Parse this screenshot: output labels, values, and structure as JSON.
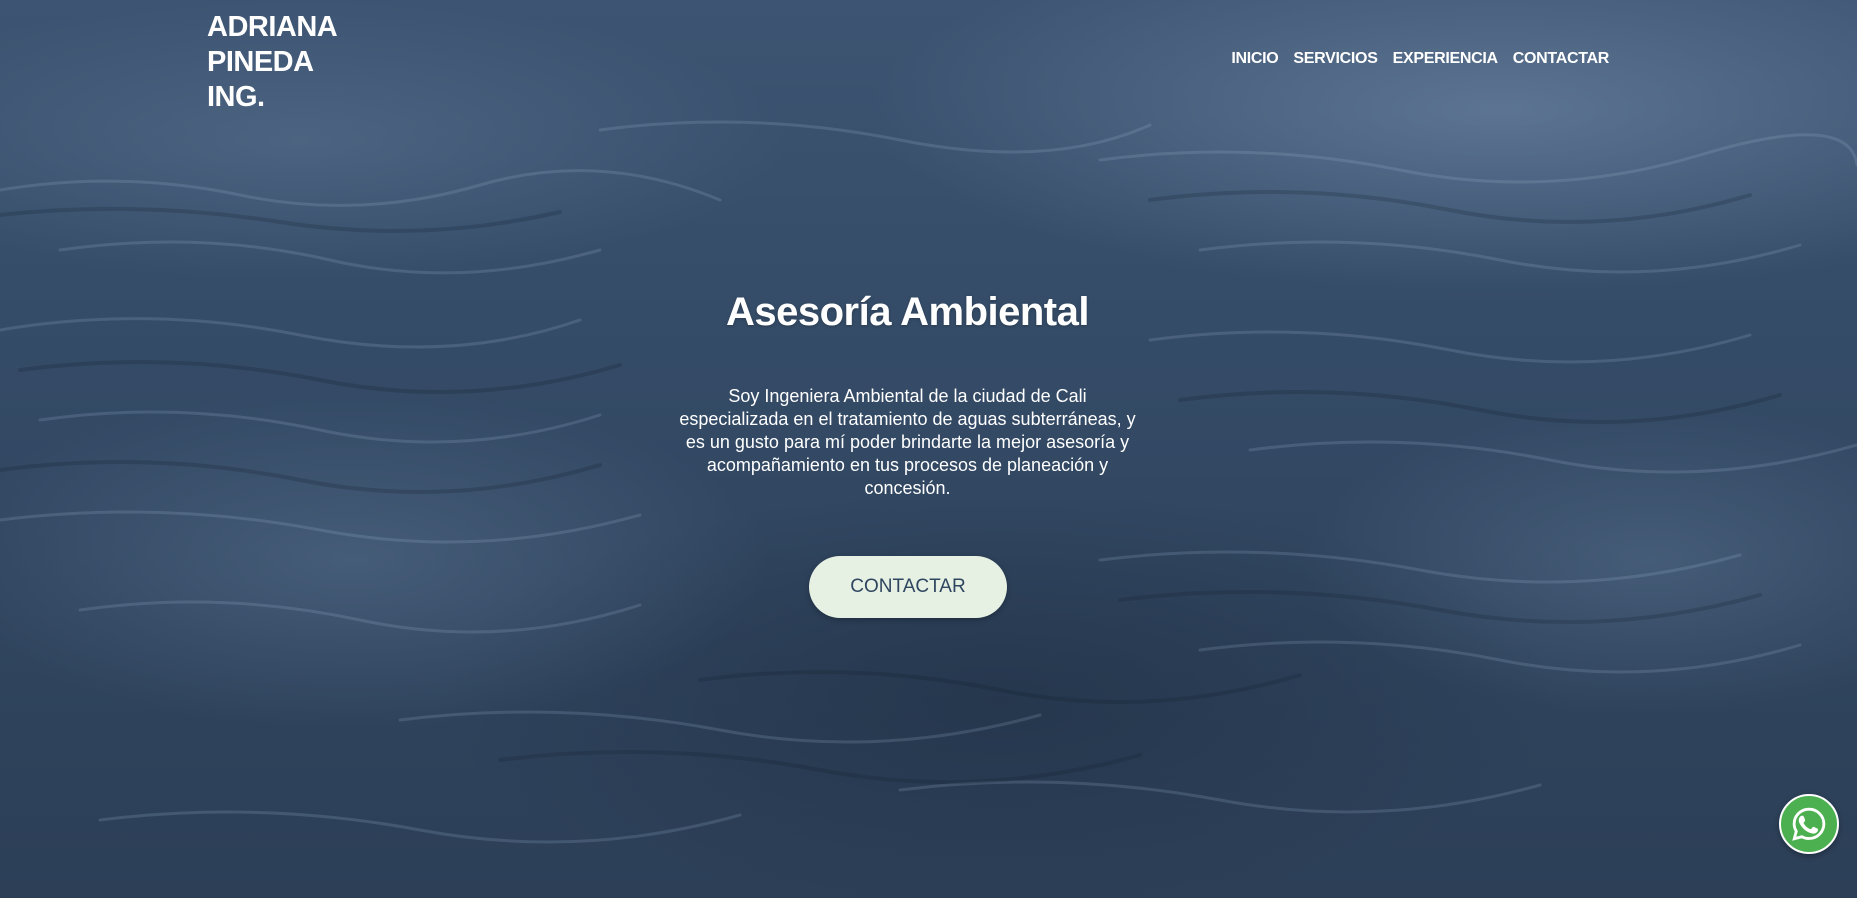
{
  "brand": {
    "lines": [
      "ADRIANA",
      "PINEDA",
      "ING."
    ]
  },
  "nav": {
    "items": [
      "INICIO",
      "SERVICIOS",
      "EXPERIENCIA",
      "CONTACTAR"
    ]
  },
  "hero": {
    "title": "Asesoría Ambiental",
    "description": "Soy Ingeniera Ambiental de la ciudad de Cali especializada en el tratamiento de aguas subterráneas, y es un gusto para mí poder brindarte la mejor asesoría y acompañamiento en tus procesos de planeación y concesión.",
    "cta_label": "CONTACTAR"
  },
  "floating": {
    "whatsapp_icon": "whatsapp-icon"
  },
  "colors": {
    "background": "#33465f",
    "cta_background": "#e6f0e3",
    "cta_text": "#2f4660",
    "whatsapp": "#4caf50"
  }
}
